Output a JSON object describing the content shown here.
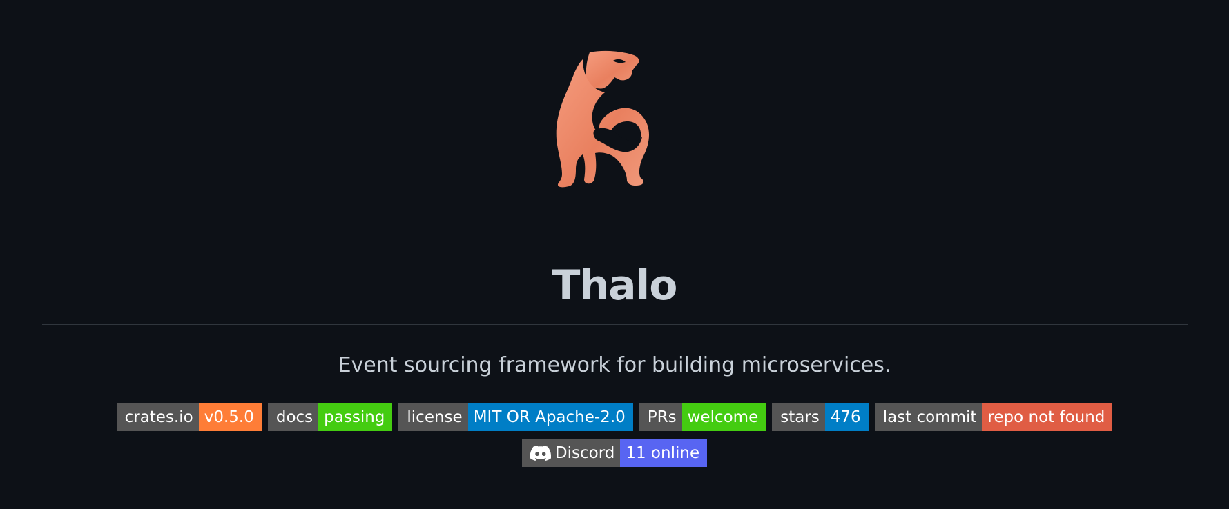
{
  "logo": {
    "icon": "thalo-cat-logo-icon",
    "colors": {
      "light": "#f39a7b",
      "dark": "#e06a48"
    }
  },
  "header": {
    "title": "Thalo"
  },
  "description": "Event sourcing framework for building microservices.",
  "badges": [
    {
      "name": "crates-io-badge",
      "label": "crates.io",
      "message": "v0.5.0",
      "color": "#fe7d37"
    },
    {
      "name": "docs-badge",
      "label": "docs",
      "message": "passing",
      "color": "#4c1"
    },
    {
      "name": "license-badge",
      "label": "license",
      "message": "MIT OR Apache-2.0",
      "color": "#007ec6"
    },
    {
      "name": "prs-badge",
      "label": "PRs",
      "message": "welcome",
      "color": "#4c1"
    },
    {
      "name": "stars-badge",
      "label": "stars",
      "message": "476",
      "color": "#007ec6"
    },
    {
      "name": "last-commit-badge",
      "label": "last commit",
      "message": "repo not found",
      "color": "#e05d44"
    }
  ],
  "discord_badge": {
    "icon": "discord-icon",
    "label": "Discord",
    "message": "11 online",
    "color": "#5865f2"
  }
}
